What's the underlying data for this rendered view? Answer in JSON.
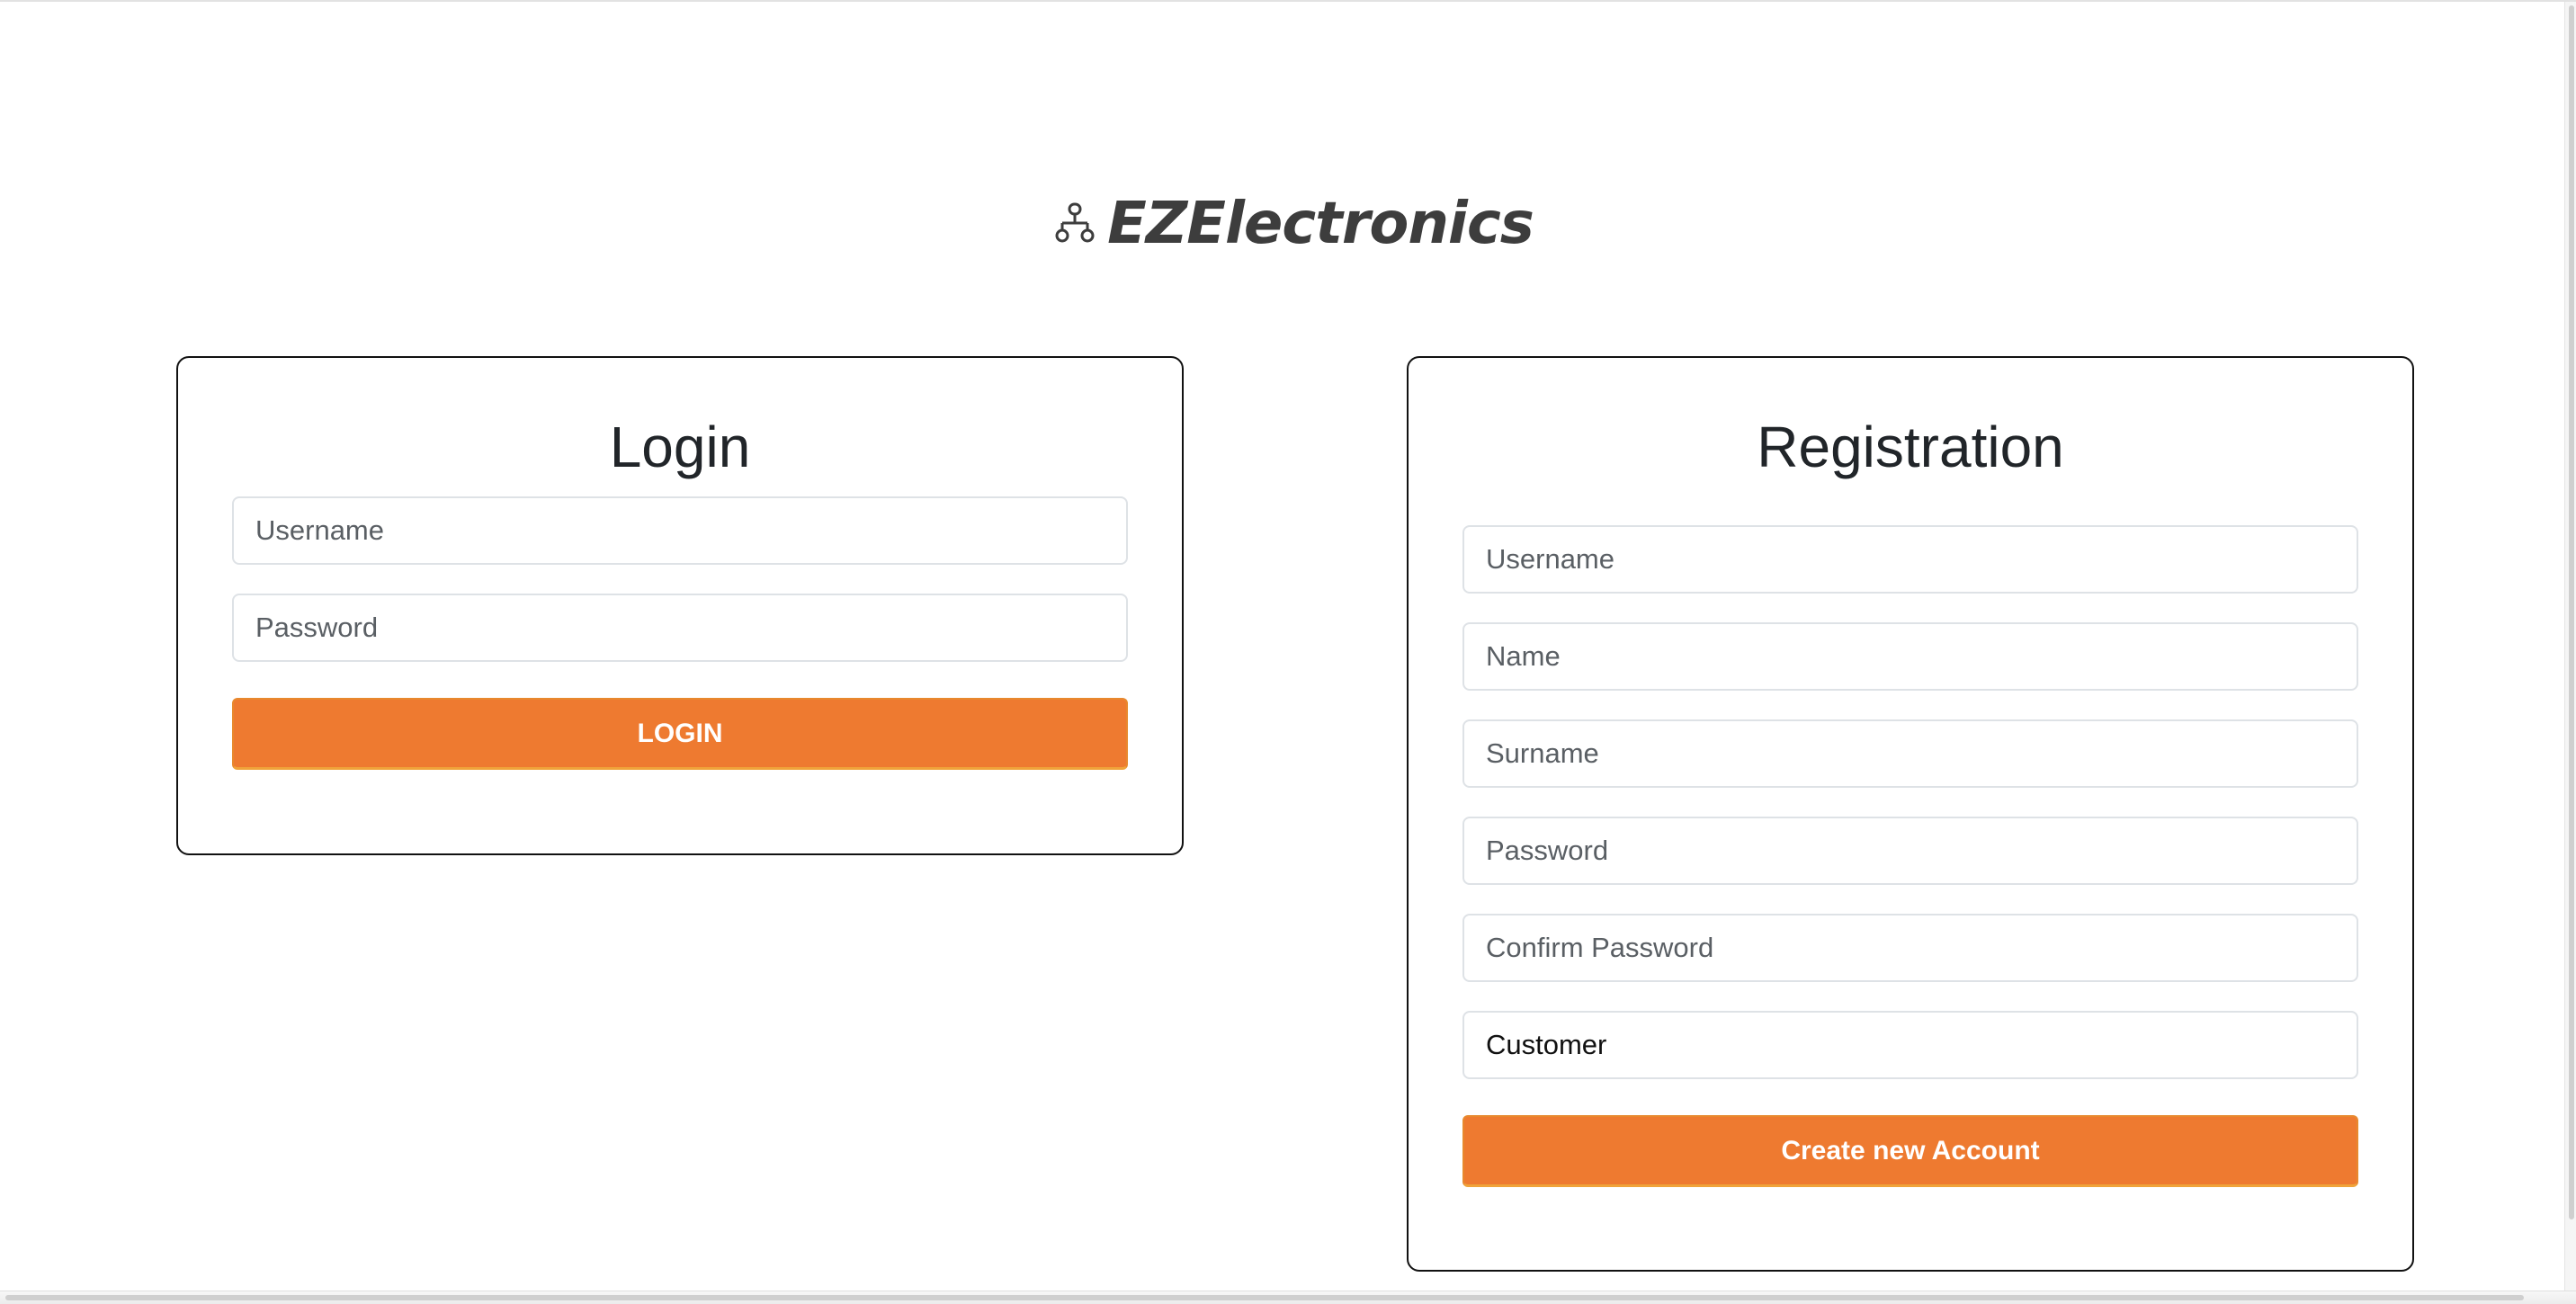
{
  "brand": {
    "icon": "sitemap-icon",
    "name": "EZElectronics"
  },
  "login": {
    "title": "Login",
    "username_placeholder": "Username",
    "password_placeholder": "Password",
    "submit_label": "LOGIN"
  },
  "registration": {
    "title": "Registration",
    "username_placeholder": "Username",
    "name_placeholder": "Name",
    "surname_placeholder": "Surname",
    "password_placeholder": "Password",
    "confirm_password_placeholder": "Confirm Password",
    "role_value": "Customer",
    "submit_label": "Create new Account"
  },
  "colors": {
    "accent": "#ee7a30",
    "text_dark": "#212529",
    "brand_text": "#3d3d3d"
  }
}
